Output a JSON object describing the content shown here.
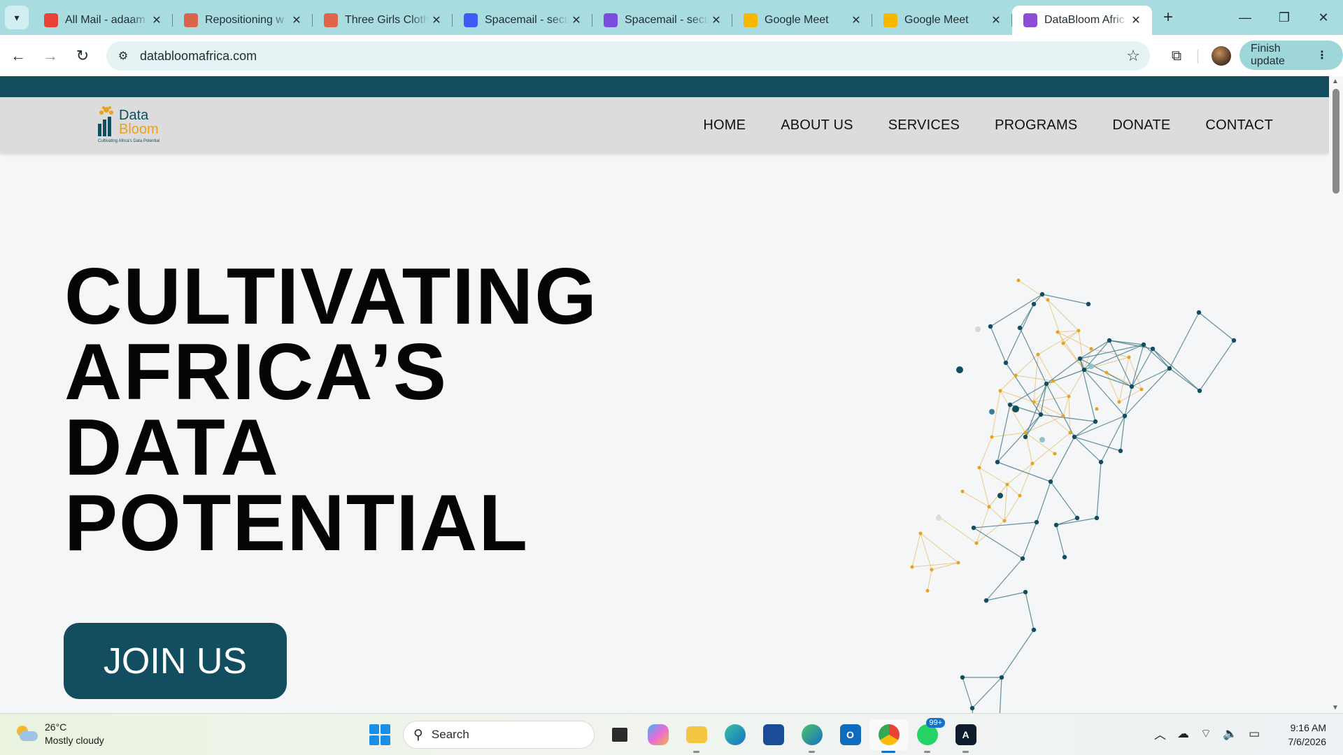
{
  "browser": {
    "tabs": [
      {
        "title": "All Mail - adaam",
        "favicon": "gmail-icon",
        "color": "#ea4335",
        "active": false
      },
      {
        "title": "Repositioning w",
        "favicon": "sparkle-icon",
        "color": "#d9664a",
        "active": false
      },
      {
        "title": "Three Girls Cloth",
        "favicon": "canva-icon",
        "color": "#e0654b",
        "active": false
      },
      {
        "title": "Spacemail - secu",
        "favicon": "spacemail-icon",
        "color": "#3d5bf5",
        "active": false
      },
      {
        "title": "Spacemail - secu",
        "favicon": "spacemail-icon",
        "color": "#7a4de0",
        "active": false
      },
      {
        "title": "Google Meet",
        "favicon": "google-meet-icon",
        "color": "#f8b800",
        "active": false
      },
      {
        "title": "Google Meet",
        "favicon": "google-meet-icon",
        "color": "#f8b800",
        "active": false
      },
      {
        "title": "DataBloom Afric",
        "favicon": "databloom-icon",
        "color": "#8e4dd8",
        "active": true
      }
    ],
    "url": "databloomafrica.com",
    "finish_update_label": "Finish update",
    "window_controls": [
      "minimize",
      "restore",
      "close"
    ]
  },
  "site": {
    "logo": {
      "line1": "Data",
      "line2": "Bloom",
      "tagline": "Cultivating Africa's Data Potential"
    },
    "nav": [
      "HOME",
      "ABOUT US",
      "SERVICES",
      "PROGRAMS",
      "DONATE",
      "CONTACT"
    ],
    "hero": {
      "lines": [
        "CULTIVATING",
        "AFRICA’S",
        "DATA",
        "POTENTIAL"
      ],
      "cta": "JOIN US"
    },
    "colors": {
      "brand_dark": "#124e5f",
      "brand_gold": "#e8a21d",
      "nav_bg": "#dcdcdc"
    }
  },
  "taskbar": {
    "weather": {
      "temp": "26°C",
      "desc": "Mostly cloudy"
    },
    "search_placeholder": "Search",
    "apps": [
      "task-view",
      "copilot",
      "file-explorer",
      "edge",
      "microsoft-store",
      "edge-beta",
      "outlook",
      "chrome",
      "whatsapp",
      "app-a"
    ],
    "whatsapp_badge": "99+",
    "time": "9:16 AM",
    "date": "7/6/2026"
  }
}
